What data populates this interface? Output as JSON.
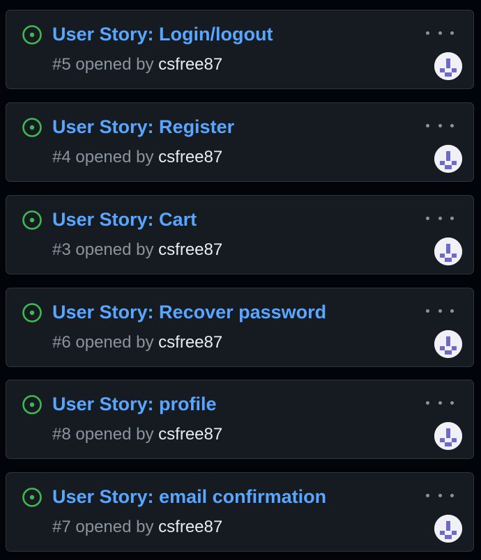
{
  "issues": [
    {
      "title": "User Story: Login/logout",
      "number": "#5",
      "opened_by": "opened by",
      "author": "csfree87"
    },
    {
      "title": "User Story: Register",
      "number": "#4",
      "opened_by": "opened by",
      "author": "csfree87"
    },
    {
      "title": "User Story: Cart",
      "number": "#3",
      "opened_by": "opened by",
      "author": "csfree87"
    },
    {
      "title": "User Story: Recover password",
      "number": "#6",
      "opened_by": "opened by",
      "author": "csfree87"
    },
    {
      "title": "User Story: profile",
      "number": "#8",
      "opened_by": "opened by",
      "author": "csfree87"
    },
    {
      "title": "User Story: email confirmation",
      "number": "#7",
      "opened_by": "opened by",
      "author": "csfree87"
    }
  ],
  "icons": {
    "status": "issue-opened-icon",
    "menu": "kebab-menu-icon",
    "avatar": "identicon-avatar"
  },
  "colors": {
    "background": "#010409",
    "card": "#161b22",
    "border": "#30363d",
    "link": "#58a6ff",
    "open": "#3fb950",
    "muted": "#8b949e",
    "text": "#e6edf3",
    "avatar": "#6e6ac8"
  }
}
